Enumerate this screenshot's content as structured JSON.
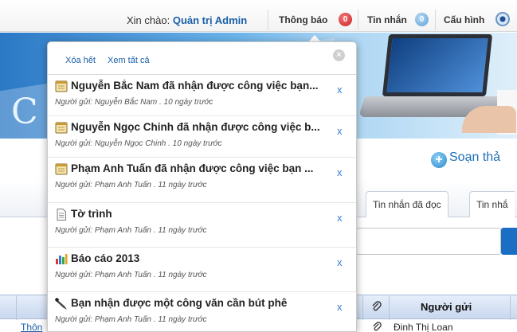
{
  "topbar": {
    "greeting": "Xin chào:",
    "user": "Quản trị Admin",
    "notifications": {
      "label": "Thông báo",
      "count": "0"
    },
    "messages": {
      "label": "Tin nhắn",
      "count": "0"
    },
    "settings": {
      "label": "Cấu hình"
    }
  },
  "main": {
    "compose_label": "Soạn thả",
    "tabs": [
      "Tin nhắn đã đọc",
      "Tin nhắ"
    ],
    "table": {
      "sender_header": "Người gửi",
      "row_left": "Thôn",
      "row_sender": "Đinh Thị Loan"
    }
  },
  "popup": {
    "clear_all": "Xóa hết",
    "view_all": "Xem tất cả",
    "close_glyph": "×",
    "dismiss_glyph": "x",
    "items": [
      {
        "icon": "notebook-icon",
        "title": "Nguyễn Bắc Nam đã nhận được công việc bạn...",
        "subtitle": "Người gửi: Nguyễn Bắc Nam . 10 ngày trước"
      },
      {
        "icon": "notebook-icon",
        "title": "Nguyễn Ngọc Chinh đã nhận được công việc b...",
        "subtitle": "Người gửi: Nguyễn Ngọc Chinh . 10 ngày trước"
      },
      {
        "icon": "notebook-icon",
        "title": "Phạm Anh Tuấn đã nhận được công việc bạn ...",
        "subtitle": "Người gửi: Phạm Anh Tuấn . 11 ngày trước"
      },
      {
        "icon": "document-icon",
        "title": "Tờ trình",
        "subtitle": "Người gửi: Phạm Anh Tuấn . 11 ngày trước"
      },
      {
        "icon": "bar-chart-icon",
        "title": "Báo cáo 2013",
        "subtitle": "Người gửi: Phạm Anh Tuấn . 11 ngày trước"
      },
      {
        "icon": "pen-icon",
        "title": "Bạn nhận được một công văn cần bút phê",
        "subtitle": "Người gửi: Phạm Anh Tuấn . 11 ngày trước"
      }
    ]
  },
  "colors": {
    "link_blue": "#1a5fa8",
    "badge_red": "#c81e1e",
    "badge_blue": "#5c9fd6"
  }
}
